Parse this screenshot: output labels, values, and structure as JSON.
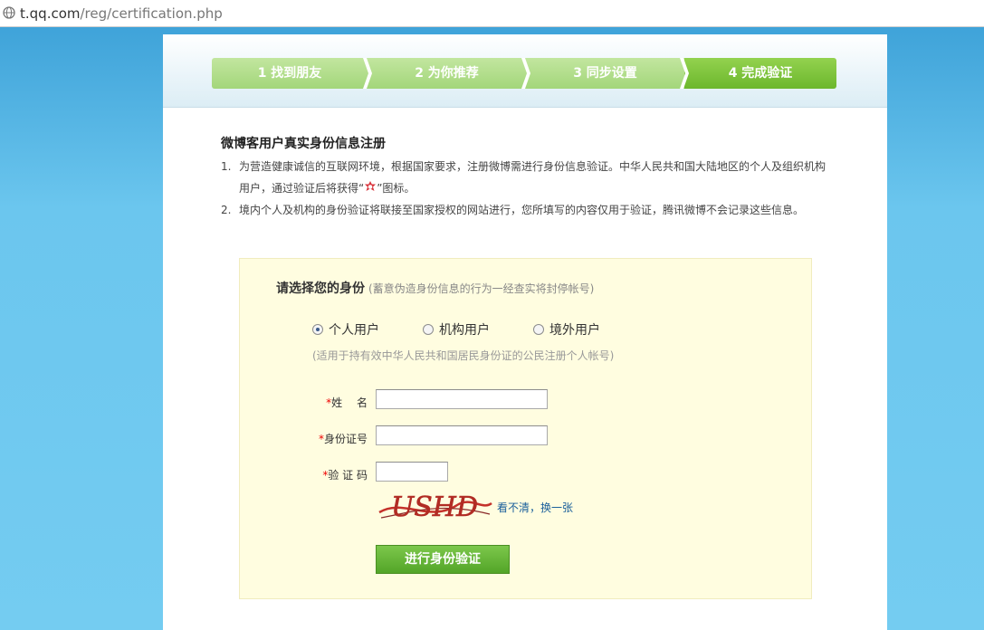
{
  "browser": {
    "url_host": "t.qq.com",
    "url_path": "/reg/certification.php"
  },
  "steps": [
    {
      "label": "1 找到朋友",
      "active": false
    },
    {
      "label": "2 为你推荐",
      "active": false
    },
    {
      "label": "3 同步设置",
      "active": false
    },
    {
      "label": "4 完成验证",
      "active": true
    }
  ],
  "intro": {
    "title": "微博客用户真实身份信息注册",
    "notes": [
      {
        "num": "1.",
        "line1": "为营造健康诚信的互联网环境，根据国家要求，注册微博需进行身份信息验证。中华人民共和国大陆地区的个人及组织机构",
        "line2_pre": "用户，通过验证后将获得“",
        "line2_post": "”图标。"
      },
      {
        "num": "2.",
        "line1": "境内个人及机构的身份验证将联接至国家授权的网站进行，您所填写的内容仅用于验证，腾讯微博不会记录这些信息。"
      }
    ]
  },
  "form": {
    "title": "请选择您的身份",
    "title_hint": "(蓄意伪造身份信息的行为一经查实将封停帐号)",
    "identity_options": [
      {
        "label": "个人用户",
        "selected": true
      },
      {
        "label": "机构用户",
        "selected": false
      },
      {
        "label": "境外用户",
        "selected": false
      }
    ],
    "identity_hint": "(适用于持有效中华人民共和国居民身份证的公民注册个人帐号)",
    "required_mark": "*",
    "fields": {
      "name_label": "姓　 名",
      "id_label": "身份证号",
      "captcha_label": "验 证 码",
      "name_value": "",
      "id_value": "",
      "captcha_value": ""
    },
    "captcha_text": "USHD",
    "refresh_link": "看不清，换一张",
    "submit_label": "进行身份验证"
  },
  "colors": {
    "accent_green": "#6cb72c",
    "step_green_light": "#a3d67a",
    "form_bg": "#fffde0",
    "required_red": "#e00000",
    "link_blue": "#1a5f9b"
  },
  "icons": {
    "browser_page": "globe-icon",
    "verified_badge": "verified-badge-icon"
  }
}
